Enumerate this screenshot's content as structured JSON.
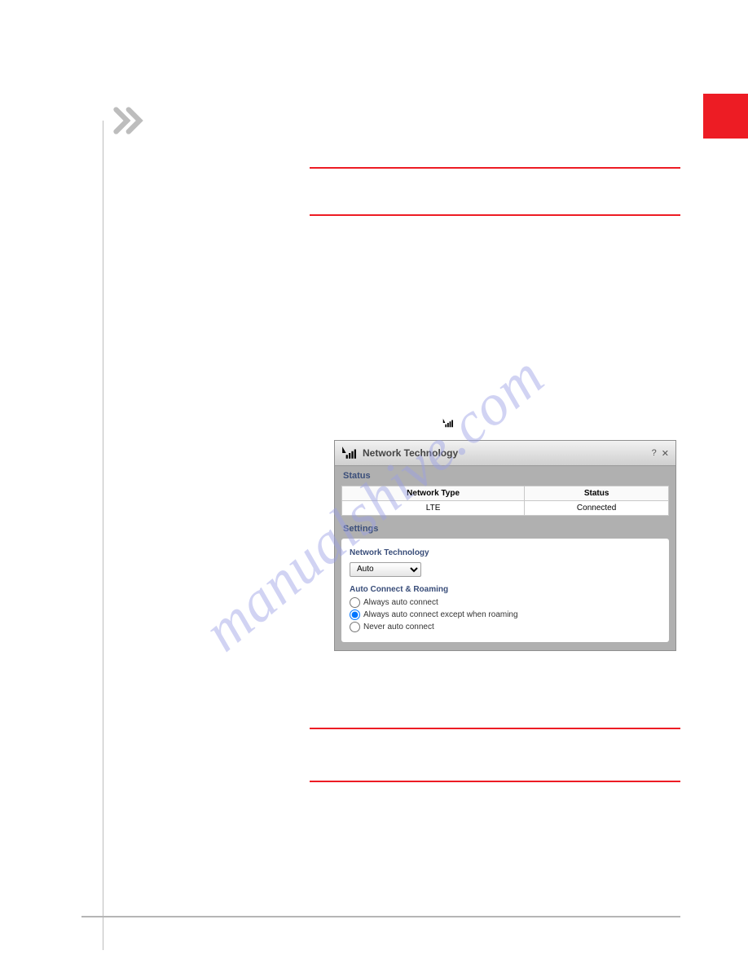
{
  "watermark": "manualshive.com",
  "dialog": {
    "title": "Network Technology",
    "help": "?",
    "close": "✕",
    "status_label": "Status",
    "settings_label": "Settings",
    "status_table": {
      "col1": "Network Type",
      "col2": "Status",
      "val1": "LTE",
      "val2": "Connected"
    },
    "nt_label": "Network Technology",
    "nt_value": "Auto",
    "acr_label": "Auto Connect & Roaming",
    "radios": {
      "r1": "Always auto connect",
      "r2": "Always auto connect except when roaming",
      "r3": "Never auto connect"
    }
  }
}
